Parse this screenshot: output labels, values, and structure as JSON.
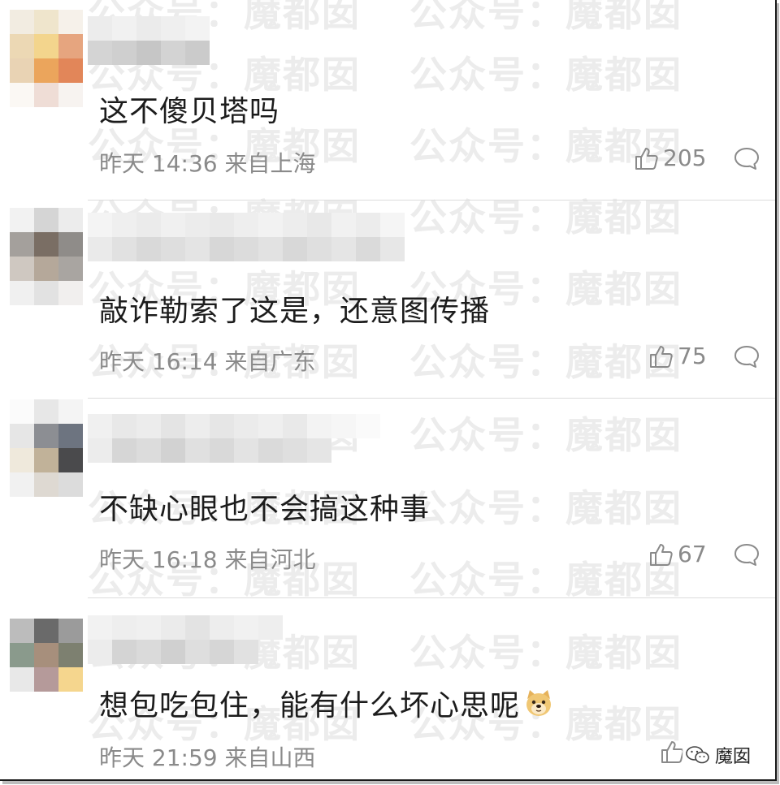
{
  "watermark": "公众号：魔都囡",
  "comments": [
    {
      "text": "这不傻贝塔吗",
      "meta": "昨天 14:36 来自上海",
      "likes": "205"
    },
    {
      "text": "敲诈勒索了这是，还意图传播",
      "meta": "昨天 16:14 来自广东",
      "likes": "75"
    },
    {
      "text": "不缺心眼也不会搞这种事",
      "meta": "昨天 16:18 来自河北",
      "likes": "67"
    },
    {
      "text": "想包吃包住，能有什么坏心思呢",
      "meta": "昨天 21:59 来自山西",
      "likes": ""
    }
  ],
  "icons": {
    "like": "thumbs-up-icon",
    "reply": "comment-bubble-icon",
    "emoji": "doge-emoji",
    "brand": "wechat-icon"
  },
  "brand_label": "魔囡",
  "colors": {
    "text": "#1c1c1c",
    "meta": "#8a8a8a",
    "divider": "#dcdcdc"
  }
}
